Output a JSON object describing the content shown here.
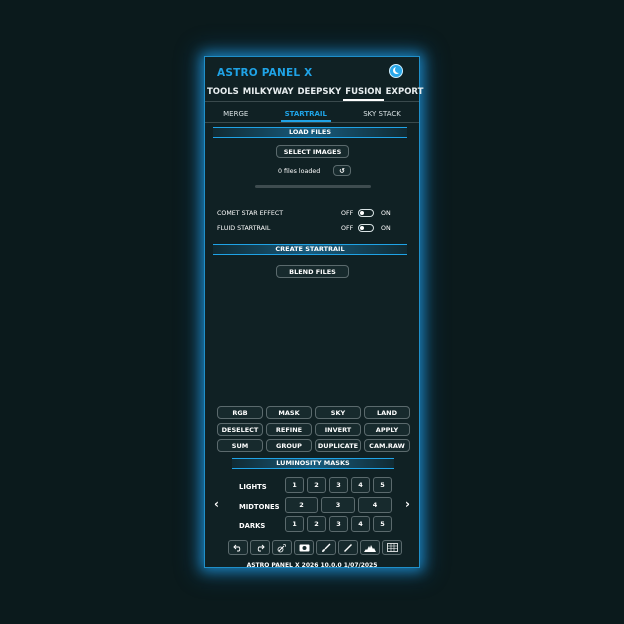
{
  "app": {
    "title": "ASTRO PANEL X",
    "footer": "ASTRO PANEL X 2026 10.0.0 1/07/2025"
  },
  "tabs": [
    {
      "label": "TOOLS"
    },
    {
      "label": "MILKYWAY"
    },
    {
      "label": "DEEPSKY"
    },
    {
      "label": "FUSION",
      "active": true
    },
    {
      "label": "EXPORT"
    }
  ],
  "subtabs": [
    {
      "label": "MERGE"
    },
    {
      "label": "STARTRAIL",
      "active": true
    },
    {
      "label": "SKY STACK"
    }
  ],
  "load_files": {
    "header": "LOAD FILES",
    "select_label": "SELECT IMAGES",
    "status": "0 files loaded",
    "refresh_icon": "↺",
    "progress": 0
  },
  "options": [
    {
      "label": "COMET STAR EFFECT",
      "off": "OFF",
      "on": "ON",
      "state": "off"
    },
    {
      "label": "FLUID STARTRAIL",
      "off": "OFF",
      "on": "ON",
      "state": "off"
    }
  ],
  "create": {
    "header": "CREATE STARTRAIL",
    "blend_label": "BLEND FILES"
  },
  "quick_buttons": [
    "RGB",
    "MASK",
    "SKY",
    "LAND",
    "DESELECT",
    "REFINE",
    "INVERT",
    "APPLY",
    "SUM",
    "GROUP",
    "DUPLICATE",
    "CAM.RAW"
  ],
  "luminosity": {
    "header": "LUMINOSITY MASKS",
    "lights_label": "LIGHTS",
    "lights": [
      "1",
      "2",
      "3",
      "4",
      "5"
    ],
    "midtones_label": "MIDTONES",
    "midtones": [
      "2",
      "3",
      "4"
    ],
    "darks_label": "DARKS",
    "darks": [
      "1",
      "2",
      "3",
      "4",
      "5"
    ],
    "prev_icon": "‹",
    "next_icon": "›"
  },
  "toolbar_icons": [
    "undo-icon",
    "redo-icon",
    "wand-icon",
    "camera-icon",
    "brush-icon",
    "pen-icon",
    "histogram-icon",
    "grid-icon"
  ],
  "colors": {
    "accent": "#1fa3e6",
    "panel_bg": "#102124",
    "page_bg": "#0b1a1c"
  }
}
